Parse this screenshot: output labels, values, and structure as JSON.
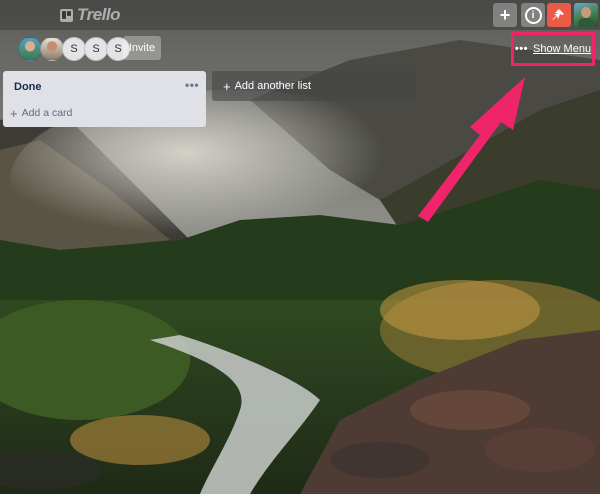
{
  "header": {
    "logo_text": "Trello",
    "buttons": [
      {
        "icon": "plus-icon",
        "glyph": "+"
      },
      {
        "icon": "info-icon",
        "glyph": "i"
      },
      {
        "icon": "notification-icon",
        "glyph": "⟡"
      }
    ],
    "accent_color": "#eb5a46"
  },
  "board": {
    "members": [
      {
        "type": "photo",
        "initial": ""
      },
      {
        "type": "photo",
        "initial": ""
      },
      {
        "type": "initial",
        "initial": "S"
      },
      {
        "type": "initial",
        "initial": "S"
      },
      {
        "type": "initial",
        "initial": "S"
      }
    ],
    "invite_label": "Invite",
    "menu_dots": "•••",
    "show_menu_label": "Show Menu",
    "highlight_color": "#f0246b"
  },
  "lists": [
    {
      "title": "Done",
      "more": "•••",
      "add_card_label": "Add a card"
    }
  ],
  "add_list_label": "Add another list"
}
